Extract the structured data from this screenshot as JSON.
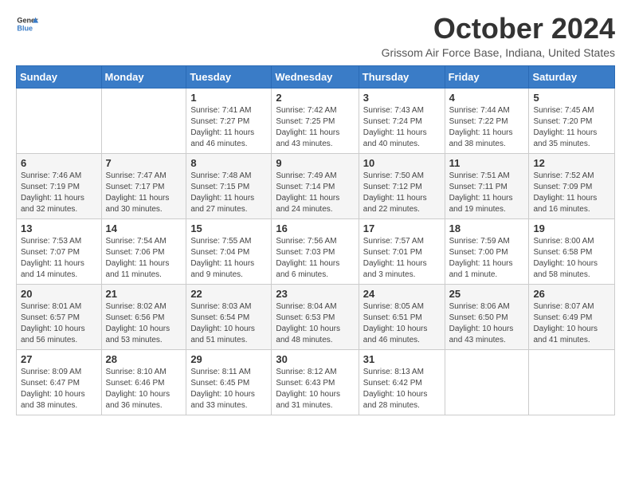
{
  "header": {
    "logo_general": "General",
    "logo_blue": "Blue",
    "title": "October 2024",
    "subtitle": "Grissom Air Force Base, Indiana, United States"
  },
  "columns": [
    "Sunday",
    "Monday",
    "Tuesday",
    "Wednesday",
    "Thursday",
    "Friday",
    "Saturday"
  ],
  "weeks": [
    [
      {
        "day": "",
        "info": ""
      },
      {
        "day": "",
        "info": ""
      },
      {
        "day": "1",
        "info": "Sunrise: 7:41 AM\nSunset: 7:27 PM\nDaylight: 11 hours and 46 minutes."
      },
      {
        "day": "2",
        "info": "Sunrise: 7:42 AM\nSunset: 7:25 PM\nDaylight: 11 hours and 43 minutes."
      },
      {
        "day": "3",
        "info": "Sunrise: 7:43 AM\nSunset: 7:24 PM\nDaylight: 11 hours and 40 minutes."
      },
      {
        "day": "4",
        "info": "Sunrise: 7:44 AM\nSunset: 7:22 PM\nDaylight: 11 hours and 38 minutes."
      },
      {
        "day": "5",
        "info": "Sunrise: 7:45 AM\nSunset: 7:20 PM\nDaylight: 11 hours and 35 minutes."
      }
    ],
    [
      {
        "day": "6",
        "info": "Sunrise: 7:46 AM\nSunset: 7:19 PM\nDaylight: 11 hours and 32 minutes."
      },
      {
        "day": "7",
        "info": "Sunrise: 7:47 AM\nSunset: 7:17 PM\nDaylight: 11 hours and 30 minutes."
      },
      {
        "day": "8",
        "info": "Sunrise: 7:48 AM\nSunset: 7:15 PM\nDaylight: 11 hours and 27 minutes."
      },
      {
        "day": "9",
        "info": "Sunrise: 7:49 AM\nSunset: 7:14 PM\nDaylight: 11 hours and 24 minutes."
      },
      {
        "day": "10",
        "info": "Sunrise: 7:50 AM\nSunset: 7:12 PM\nDaylight: 11 hours and 22 minutes."
      },
      {
        "day": "11",
        "info": "Sunrise: 7:51 AM\nSunset: 7:11 PM\nDaylight: 11 hours and 19 minutes."
      },
      {
        "day": "12",
        "info": "Sunrise: 7:52 AM\nSunset: 7:09 PM\nDaylight: 11 hours and 16 minutes."
      }
    ],
    [
      {
        "day": "13",
        "info": "Sunrise: 7:53 AM\nSunset: 7:07 PM\nDaylight: 11 hours and 14 minutes."
      },
      {
        "day": "14",
        "info": "Sunrise: 7:54 AM\nSunset: 7:06 PM\nDaylight: 11 hours and 11 minutes."
      },
      {
        "day": "15",
        "info": "Sunrise: 7:55 AM\nSunset: 7:04 PM\nDaylight: 11 hours and 9 minutes."
      },
      {
        "day": "16",
        "info": "Sunrise: 7:56 AM\nSunset: 7:03 PM\nDaylight: 11 hours and 6 minutes."
      },
      {
        "day": "17",
        "info": "Sunrise: 7:57 AM\nSunset: 7:01 PM\nDaylight: 11 hours and 3 minutes."
      },
      {
        "day": "18",
        "info": "Sunrise: 7:59 AM\nSunset: 7:00 PM\nDaylight: 11 hours and 1 minute."
      },
      {
        "day": "19",
        "info": "Sunrise: 8:00 AM\nSunset: 6:58 PM\nDaylight: 10 hours and 58 minutes."
      }
    ],
    [
      {
        "day": "20",
        "info": "Sunrise: 8:01 AM\nSunset: 6:57 PM\nDaylight: 10 hours and 56 minutes."
      },
      {
        "day": "21",
        "info": "Sunrise: 8:02 AM\nSunset: 6:56 PM\nDaylight: 10 hours and 53 minutes."
      },
      {
        "day": "22",
        "info": "Sunrise: 8:03 AM\nSunset: 6:54 PM\nDaylight: 10 hours and 51 minutes."
      },
      {
        "day": "23",
        "info": "Sunrise: 8:04 AM\nSunset: 6:53 PM\nDaylight: 10 hours and 48 minutes."
      },
      {
        "day": "24",
        "info": "Sunrise: 8:05 AM\nSunset: 6:51 PM\nDaylight: 10 hours and 46 minutes."
      },
      {
        "day": "25",
        "info": "Sunrise: 8:06 AM\nSunset: 6:50 PM\nDaylight: 10 hours and 43 minutes."
      },
      {
        "day": "26",
        "info": "Sunrise: 8:07 AM\nSunset: 6:49 PM\nDaylight: 10 hours and 41 minutes."
      }
    ],
    [
      {
        "day": "27",
        "info": "Sunrise: 8:09 AM\nSunset: 6:47 PM\nDaylight: 10 hours and 38 minutes."
      },
      {
        "day": "28",
        "info": "Sunrise: 8:10 AM\nSunset: 6:46 PM\nDaylight: 10 hours and 36 minutes."
      },
      {
        "day": "29",
        "info": "Sunrise: 8:11 AM\nSunset: 6:45 PM\nDaylight: 10 hours and 33 minutes."
      },
      {
        "day": "30",
        "info": "Sunrise: 8:12 AM\nSunset: 6:43 PM\nDaylight: 10 hours and 31 minutes."
      },
      {
        "day": "31",
        "info": "Sunrise: 8:13 AM\nSunset: 6:42 PM\nDaylight: 10 hours and 28 minutes."
      },
      {
        "day": "",
        "info": ""
      },
      {
        "day": "",
        "info": ""
      }
    ]
  ]
}
